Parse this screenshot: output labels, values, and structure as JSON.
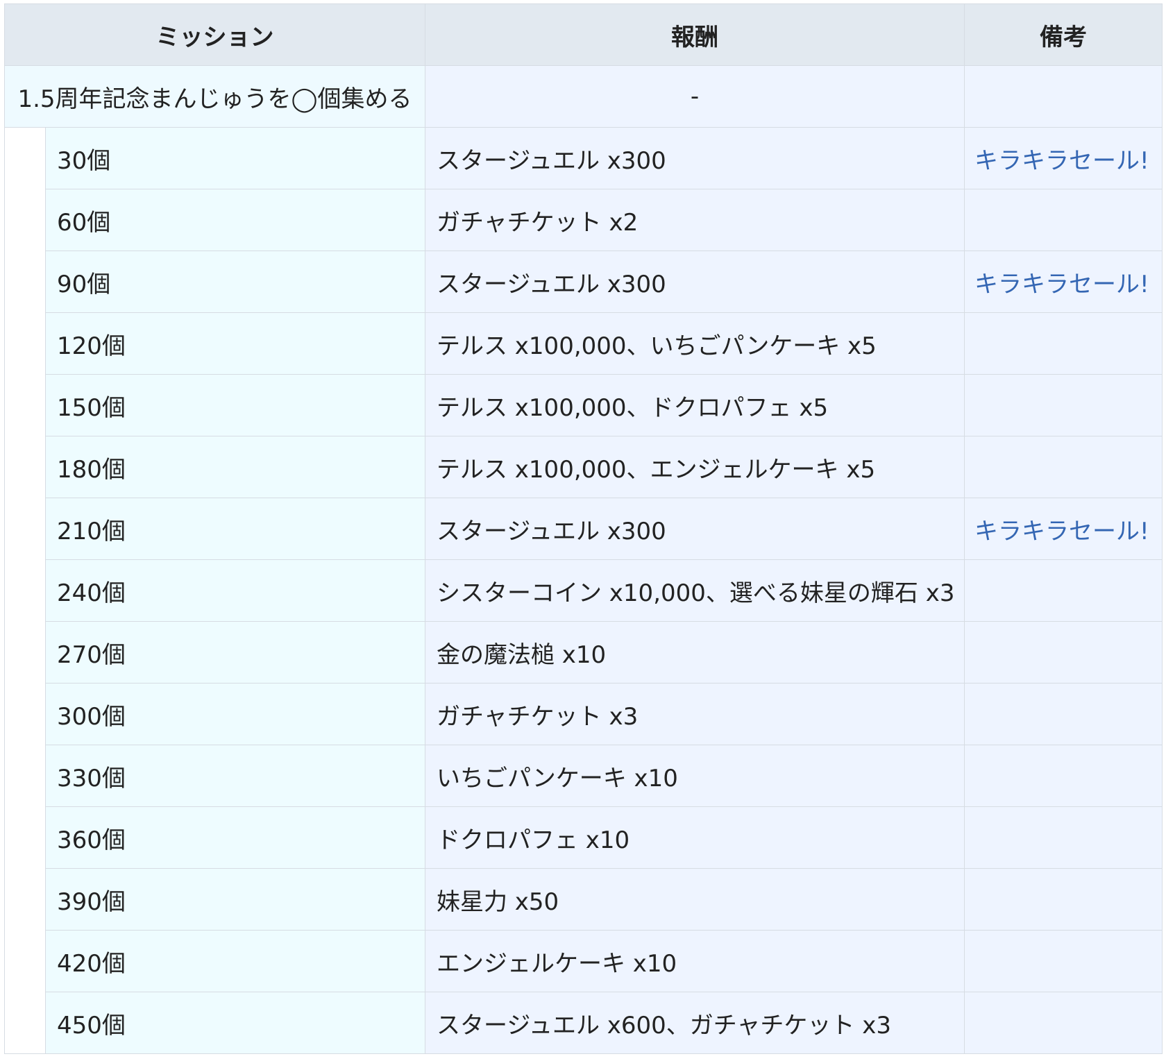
{
  "headers": {
    "mission": "ミッション",
    "reward": "報酬",
    "note": "備考"
  },
  "main_mission": {
    "name": "1.5周年記念まんじゅうを◯個集める",
    "reward": "-",
    "note": ""
  },
  "rows": [
    {
      "count": "30個",
      "reward": "スタージュエル x300",
      "note": "キラキラセール!"
    },
    {
      "count": "60個",
      "reward": "ガチャチケット x2",
      "note": ""
    },
    {
      "count": "90個",
      "reward": "スタージュエル x300",
      "note": "キラキラセール!"
    },
    {
      "count": "120個",
      "reward": "テルス x100,000、いちごパンケーキ x5",
      "note": ""
    },
    {
      "count": "150個",
      "reward": "テルス x100,000、ドクロパフェ x5",
      "note": ""
    },
    {
      "count": "180個",
      "reward": "テルス x100,000、エンジェルケーキ x5",
      "note": ""
    },
    {
      "count": "210個",
      "reward": "スタージュエル x300",
      "note": "キラキラセール!"
    },
    {
      "count": "240個",
      "reward": "シスターコイン x10,000、選べる妹星の輝石 x3",
      "note": ""
    },
    {
      "count": "270個",
      "reward": "金の魔法槌 x10",
      "note": ""
    },
    {
      "count": "300個",
      "reward": "ガチャチケット x3",
      "note": ""
    },
    {
      "count": "330個",
      "reward": "いちごパンケーキ x10",
      "note": ""
    },
    {
      "count": "360個",
      "reward": "ドクロパフェ x10",
      "note": ""
    },
    {
      "count": "390個",
      "reward": "妹星力 x50",
      "note": ""
    },
    {
      "count": "420個",
      "reward": "エンジェルケーキ x10",
      "note": ""
    },
    {
      "count": "450個",
      "reward": "スタージュエル x600、ガチャチケット x3",
      "note": ""
    }
  ],
  "colors": {
    "header_bg": "#e2e9f0",
    "mission_bg": "#eefcff",
    "reward_bg": "#eef4ff",
    "border": "#d6dce3",
    "link": "#3466b3"
  }
}
